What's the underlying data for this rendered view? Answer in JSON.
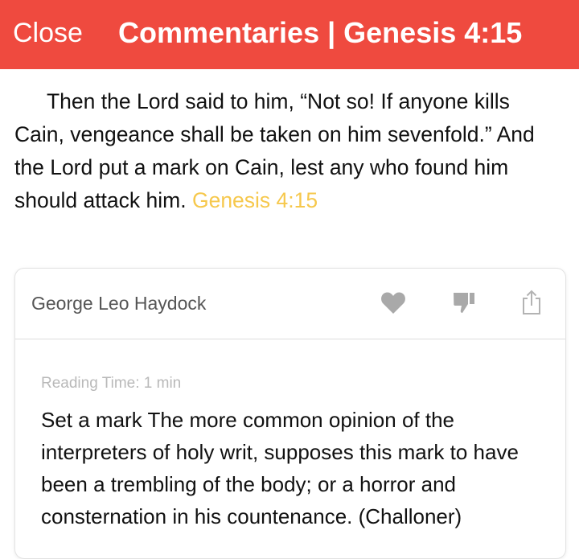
{
  "header": {
    "close_label": "Close",
    "title": "Commentaries | Genesis 4:15",
    "background_color": "#ef4a3f"
  },
  "verse": {
    "text": "Then the Lord said to him, “Not so! If anyone kills Cain, vengeance shall be taken on him sevenfold.” And the Lord put a mark on Cain, lest any who found him should attack him.",
    "reference": "Genesis 4:15",
    "reference_color": "#f6c84c"
  },
  "commentary_card": {
    "author": "George Leo Haydock",
    "icons": {
      "like": "heart-icon",
      "dislike": "thumbs-down-icon",
      "share": "share-icon"
    },
    "reading_time": "Reading Time: 1 min",
    "text": "Set a mark The more common opinion of the interpreters of holy writ, supposes this mark to have been a trembling of the body; or a horror and consternation in his countenance. (Challoner)"
  }
}
